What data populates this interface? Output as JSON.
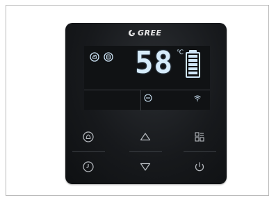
{
  "brand": {
    "logo_text": "GREE",
    "logo_icon": "gree-swirl-icon"
  },
  "display": {
    "mode_icons": [
      "heating-mode-icon",
      "water-tank-mode-icon"
    ],
    "temperature": "58",
    "unit": "℃",
    "level": {
      "icon": "battery-level-icon",
      "bars_filled": 5,
      "bars_total": 5
    },
    "status_icons": [
      "silent-mode-icon",
      "wifi-icon"
    ]
  },
  "keys": {
    "top_row": [
      "mode-button",
      "up-button",
      "menu-button"
    ],
    "bottom_row": [
      "timer-button",
      "down-button",
      "power-button"
    ]
  },
  "colors": {
    "panel": "#17191c",
    "lcd_text": "#d6ecfb",
    "key_icon": "#b8bcc1"
  }
}
